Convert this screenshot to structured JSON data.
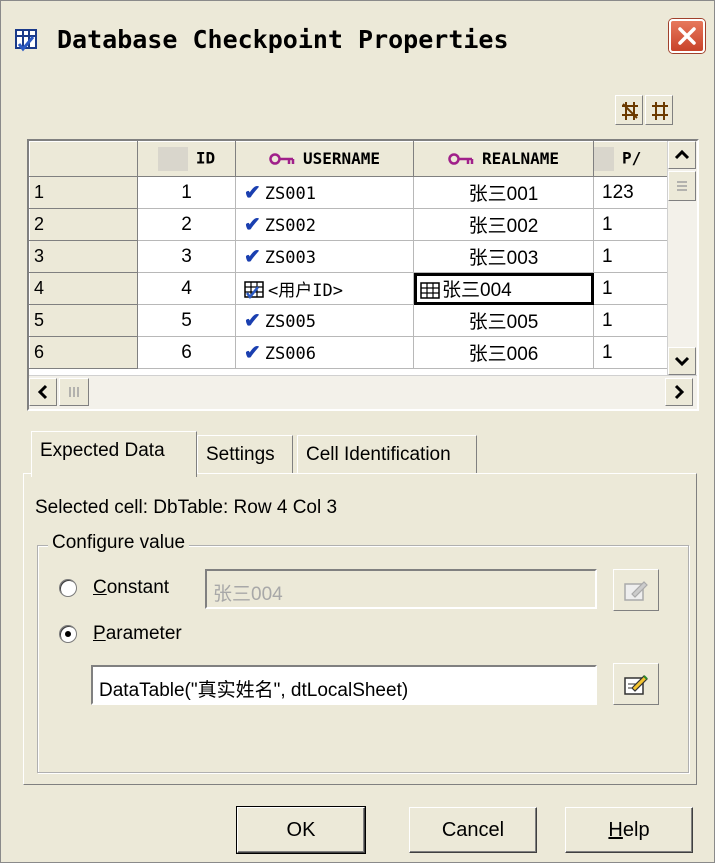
{
  "window": {
    "title": "Database Checkpoint Properties",
    "close_icon": "close-icon"
  },
  "grid": {
    "columns": [
      {
        "label": "",
        "icon": ""
      },
      {
        "label": "ID",
        "icon": "column-square-icon"
      },
      {
        "label": "USERNAME",
        "icon": "key-icon"
      },
      {
        "label": "REALNAME",
        "icon": "key-icon"
      },
      {
        "label": "P/",
        "icon": "column-square-icon"
      }
    ],
    "rows": [
      {
        "row": "1",
        "id": "1",
        "username": "ZS001",
        "realname": "张三001",
        "p": "123",
        "username_mark": "check"
      },
      {
        "row": "2",
        "id": "2",
        "username": "ZS002",
        "realname": "张三002",
        "p": "1",
        "username_mark": "check"
      },
      {
        "row": "3",
        "id": "3",
        "username": "ZS003",
        "realname": "张三003",
        "p": "1",
        "username_mark": "check"
      },
      {
        "row": "4",
        "id": "4",
        "username": "<用户ID>",
        "realname": "张三004",
        "p": "1",
        "username_mark": "param"
      },
      {
        "row": "5",
        "id": "5",
        "username": "ZS005",
        "realname": "张三005",
        "p": "1",
        "username_mark": "check"
      },
      {
        "row": "6",
        "id": "6",
        "username": "ZS006",
        "realname": "张三006",
        "p": "1",
        "username_mark": "check"
      }
    ]
  },
  "tabs": [
    {
      "label": "Expected Data",
      "active": true
    },
    {
      "label": "Settings",
      "active": false
    },
    {
      "label": "Cell Identification",
      "active": false
    }
  ],
  "panel": {
    "selected_cell": "Selected cell: DbTable: Row 4 Col 3",
    "group_title": "Configure value",
    "constant_label": "Constant",
    "constant_value": "张三004",
    "parameter_label": "Parameter",
    "parameter_value": "DataTable(\"真实姓名\", dtLocalSheet)",
    "selected_option": "Parameter"
  },
  "buttons": {
    "ok": "OK",
    "cancel": "Cancel",
    "help": "Help"
  }
}
